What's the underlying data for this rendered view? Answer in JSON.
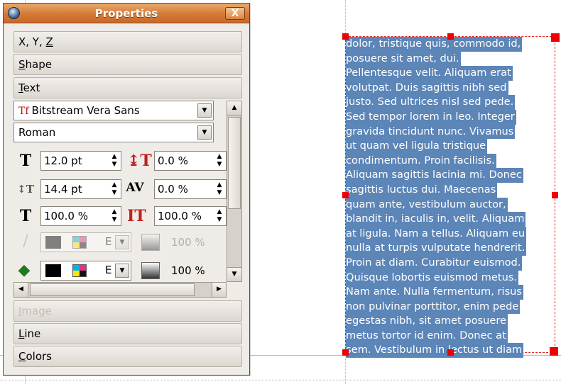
{
  "window": {
    "title": "Properties",
    "close_label": "X"
  },
  "sections": {
    "xyz": {
      "pre": "X, Y, ",
      "key": "Z",
      "post": ""
    },
    "shape": {
      "pre": "",
      "key": "S",
      "post": "hape"
    },
    "text": {
      "pre": "",
      "key": "T",
      "post": "ext"
    },
    "image": {
      "pre": "",
      "key": "I",
      "post": "mage"
    },
    "line": {
      "pre": "",
      "key": "L",
      "post": "ine"
    },
    "colors": {
      "pre": "",
      "key": "C",
      "post": "olors"
    }
  },
  "text_panel": {
    "font_family": "Bitstream Vera Sans",
    "font_style": "Roman",
    "font_size": "12.0 pt",
    "offset": "0.0 %",
    "line_spacing": "14.4 pt",
    "tracking": "0.0 %",
    "scale_width": "100.0 %",
    "scale_height": "100.0 %",
    "stroke_shade": "100 %",
    "fill_shade": "100 %",
    "color_letter": "E"
  },
  "text_frame": {
    "lines": [
      "dolor, tristique quis, commodo id,",
      "posuere sit amet, dui.",
      "Pellentesque velit. Aliquam erat",
      "volutpat. Duis sagittis nibh sed",
      "justo. Sed ultrices nisl sed pede.",
      "Sed tempor lorem in leo. Integer",
      "gravida tincidunt nunc. Vivamus",
      "ut quam vel ligula tristique",
      "condimentum. Proin facilisis.",
      "Aliquam sagittis lacinia mi. Donec",
      "sagittis luctus dui. Maecenas",
      "quam ante, vestibulum auctor,",
      "blandit in, iaculis in, velit. Aliquam",
      "at ligula. Nam a tellus. Aliquam eu",
      "nulla at turpis vulputate hendrerit.",
      "Proin at diam. Curabitur euismod.",
      "Quisque lobortis euismod metus.",
      "Nam ante. Nulla fermentum, risus",
      "non pulvinar porttitor, enim pede",
      "egestas nibh, sit amet posuere",
      "metus tortor id enim. Donec at",
      "sem. Vestibulum in lectus ut diam"
    ],
    "highlight_color": "#5c85b8",
    "handle_color": "#ee0000"
  },
  "icons": {
    "title": "app-globe-icon",
    "font": "font-type-icon",
    "size": "font-size-icon",
    "offset": "baseline-offset-icon",
    "line_spacing": "line-spacing-icon",
    "tracking": "tracking-icon",
    "scale_w": "scale-width-icon",
    "scale_h": "scale-height-icon",
    "stroke": "stroke-pen-icon",
    "fill": "fill-bucket-icon"
  }
}
